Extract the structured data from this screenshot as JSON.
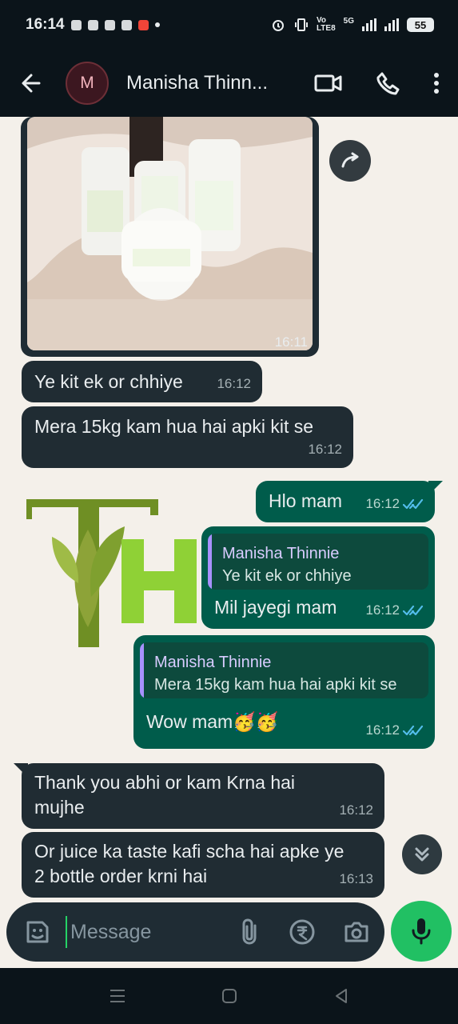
{
  "status_bar": {
    "time": "16:14",
    "network_top": "Vo",
    "network_bottom": "LTE8",
    "network_gen": "5G",
    "battery": "55"
  },
  "header": {
    "avatar_letter": "M",
    "contact_name": "Manisha Thinn..."
  },
  "messages": {
    "image_time": "16:11",
    "m1": {
      "text": "Ye kit ek or chhiye",
      "time": "16:12"
    },
    "m2": {
      "text": "Mera 15kg kam hua hai apki kit se",
      "time": "16:12"
    },
    "m3": {
      "text": "Hlo mam",
      "time": "16:12"
    },
    "m4": {
      "quote_name": "Manisha Thinnie",
      "quote_text": "Ye kit ek or chhiye",
      "text": "Mil jayegi mam",
      "time": "16:12"
    },
    "m5": {
      "quote_name": "Manisha Thinnie",
      "quote_text": "Mera 15kg kam hua hai apki kit se",
      "text": "Wow mam🥳🥳",
      "time": "16:12"
    },
    "m6": {
      "line1": "Thank you abhi or kam Krna hai",
      "line2": "mujhe",
      "time": "16:12"
    },
    "m7": {
      "line1": "Or juice ka taste kafi scha hai apke ye",
      "line2": "2 bottle order krni hai",
      "time": "16:13"
    }
  },
  "composer": {
    "placeholder": "Message"
  },
  "colors": {
    "dark_bg": "#0b141a",
    "incoming": "#202c33",
    "outgoing": "#005c4b",
    "accent": "#21c063"
  }
}
